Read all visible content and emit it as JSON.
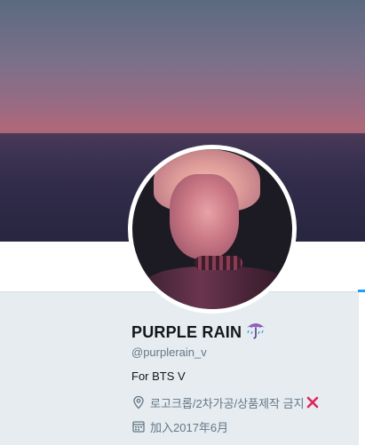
{
  "profile": {
    "name": "PURPLE RAIN",
    "name_emoji": "umbrella-with-rain-icon",
    "handle": "@purplerain_v",
    "bio": "For BTS V",
    "location": "로고크롭/2차가공/상품제작 금지",
    "location_suffix_icon": "red-x-icon",
    "joined": "加入2017年6月"
  },
  "colors": {
    "accent": "#1da1f2",
    "name_text": "#14171a",
    "muted_text": "#657786",
    "panel_bg": "#e6ecf0",
    "x_mark": "#e0245e"
  },
  "icons": {
    "location": "location-pin-icon",
    "joined": "calendar-icon"
  }
}
